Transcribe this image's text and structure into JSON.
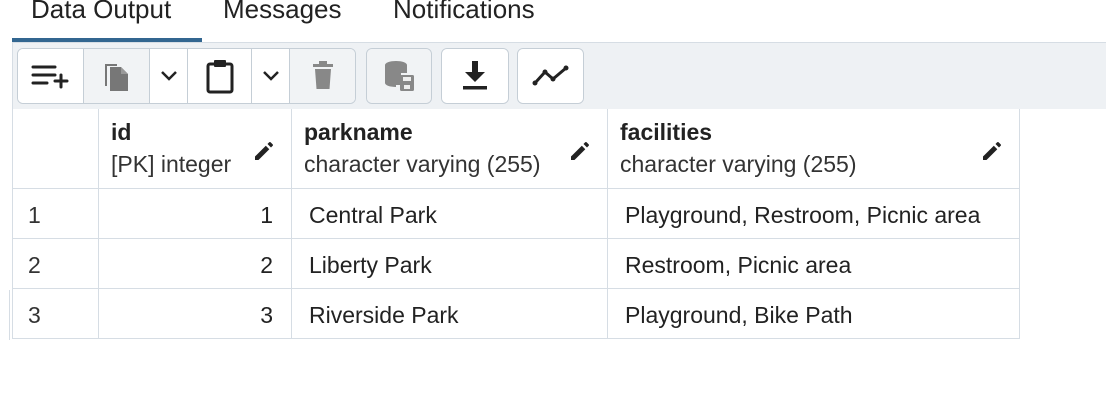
{
  "tabs": [
    {
      "label": "Data Output",
      "active": true
    },
    {
      "label": "Messages",
      "active": false
    },
    {
      "label": "Notifications",
      "active": false
    }
  ],
  "toolbar": {
    "buttons": [
      {
        "icon": "add-row-icon"
      },
      {
        "icon": "copy-icon"
      },
      {
        "icon": "chevron-down-icon"
      },
      {
        "icon": "paste-icon"
      },
      {
        "icon": "chevron-down-icon"
      },
      {
        "icon": "delete-icon"
      },
      {
        "icon": "save-data-icon"
      },
      {
        "icon": "download-icon"
      },
      {
        "icon": "graph-icon"
      }
    ]
  },
  "grid": {
    "columns": [
      {
        "name": "id",
        "type": "[PK] integer"
      },
      {
        "name": "parkname",
        "type": "character varying (255)"
      },
      {
        "name": "facilities",
        "type": "character varying (255)"
      }
    ],
    "rows": [
      {
        "num": "1",
        "id": "1",
        "parkname": "Central Park",
        "facilities": "Playground, Restroom, Picnic area"
      },
      {
        "num": "2",
        "id": "2",
        "parkname": "Liberty Park",
        "facilities": "Restroom, Picnic area"
      },
      {
        "num": "3",
        "id": "3",
        "parkname": "Riverside Park",
        "facilities": "Playground, Bike Path"
      }
    ]
  },
  "colors": {
    "accent": "#326690",
    "toolbar_bg": "#eef1f4",
    "border": "#d6dde4"
  }
}
